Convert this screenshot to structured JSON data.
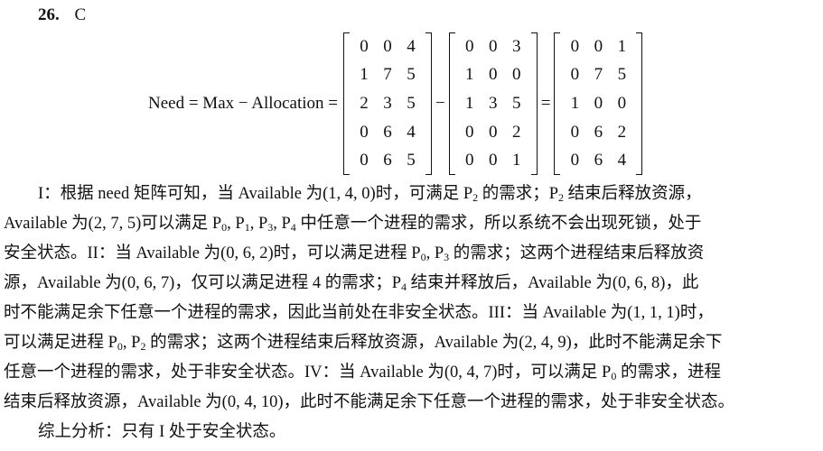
{
  "header": {
    "number": "26.",
    "answer": "C"
  },
  "equation": {
    "label": "Need = Max − Allocation =",
    "minus": "−",
    "equals": "=",
    "matrices": [
      [
        [
          "0",
          "0",
          "4"
        ],
        [
          "1",
          "7",
          "5"
        ],
        [
          "2",
          "3",
          "5"
        ],
        [
          "0",
          "6",
          "4"
        ],
        [
          "0",
          "6",
          "5"
        ]
      ],
      [
        [
          "0",
          "0",
          "3"
        ],
        [
          "1",
          "0",
          "0"
        ],
        [
          "1",
          "3",
          "5"
        ],
        [
          "0",
          "0",
          "2"
        ],
        [
          "0",
          "0",
          "1"
        ]
      ],
      [
        [
          "0",
          "0",
          "1"
        ],
        [
          "0",
          "7",
          "5"
        ],
        [
          "1",
          "0",
          "0"
        ],
        [
          "0",
          "6",
          "2"
        ],
        [
          "0",
          "6",
          "4"
        ]
      ]
    ]
  },
  "text": {
    "l1a": "I：根据 need 矩阵可知，当 Available 为(1, 4, 0)时，可满足 P",
    "l1s1": "2",
    "l1b": " 的需求；P",
    "l1s2": "2",
    "l1c": " 结束后释放资源，",
    "l2a": "Available 为(2, 7, 5)可以满足 P",
    "l2s1": "0",
    "l2b": ", P",
    "l2s2": "1",
    "l2c": ", P",
    "l2s3": "3",
    "l2d": ", P",
    "l2s4": "4",
    "l2e": " 中任意一个进程的需求，所以系统不会出现死锁，处于",
    "l3a": "安全状态。II：当 Available 为(0, 6, 2)时，可以满足进程 P",
    "l3s1": "0",
    "l3b": ", P",
    "l3s2": "3",
    "l3c": " 的需求；这两个进程结束后释放资",
    "l4a": "源，Available 为(0, 6, 7)，仅可以满足进程 4 的需求；P",
    "l4s1": "4",
    "l4b": " 结束并释放后，Available 为(0, 6, 8)，此",
    "l5": "时不能满足余下任意一个进程的需求，因此当前处在非安全状态。III：当 Available 为(1, 1, 1)时，",
    "l6a": "可以满足进程 P",
    "l6s1": "0",
    "l6b": ", P",
    "l6s2": "2",
    "l6c": " 的需求；这两个进程结束后释放资源，Available 为(2, 4, 9)，此时不能满足余下",
    "l7a": "任意一个进程的需求，处于非安全状态。IV：当 Available 为(0, 4, 7)时，可以满足 P",
    "l7s1": "0",
    "l7b": " 的需求，进程",
    "l8": "结束后释放资源，Available 为(0, 4, 10)，此时不能满足余下任意一个进程的需求，处于非安全状态。",
    "l9": "综上分析：只有 I 处于安全状态。"
  }
}
